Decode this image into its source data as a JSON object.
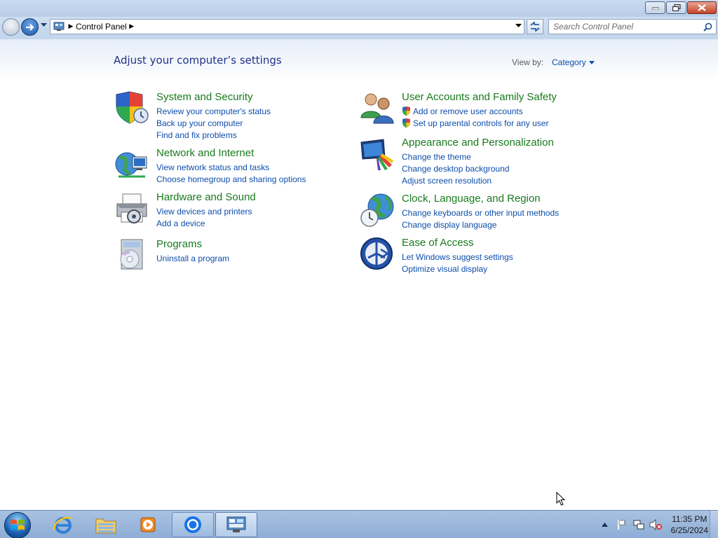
{
  "window": {
    "minimize_icon": "minimize-icon",
    "restore_icon": "restore-icon",
    "close_icon": "close-icon"
  },
  "address": {
    "crumb": "Control Panel",
    "search_placeholder": "Search Control Panel"
  },
  "header": {
    "title": "Adjust your computer’s settings",
    "view_by_label": "View by:",
    "view_by_value": "Category"
  },
  "categories": [
    {
      "title": "System and Security",
      "icon": "shield-icon",
      "links": [
        "Review your computer's status",
        "Back up your computer",
        "Find and fix problems"
      ]
    },
    {
      "title": "Network and Internet",
      "icon": "network-globe-icon",
      "links": [
        "View network status and tasks",
        "Choose homegroup and sharing options"
      ]
    },
    {
      "title": "Hardware and Sound",
      "icon": "printer-icon",
      "links": [
        "View devices and printers",
        "Add a device"
      ]
    },
    {
      "title": "Programs",
      "icon": "programs-cd-icon",
      "links": [
        "Uninstall a program"
      ]
    },
    {
      "title": "User Accounts and Family Safety",
      "icon": "users-icon",
      "links": [
        "Add or remove user accounts",
        "Set up parental controls for any user"
      ]
    },
    {
      "title": "Appearance and Personalization",
      "icon": "monitor-paint-icon",
      "links": [
        "Change the theme",
        "Change desktop background",
        "Adjust screen resolution"
      ]
    },
    {
      "title": "Clock, Language, and Region",
      "icon": "clock-globe-icon",
      "links": [
        "Change keyboards or other input methods",
        "Change display language"
      ]
    },
    {
      "title": "Ease of Access",
      "icon": "ease-of-access-icon",
      "links": [
        "Let Windows suggest settings",
        "Optimize visual display"
      ]
    }
  ],
  "taskbar": {
    "time": "11:35 PM",
    "date": "6/25/2024"
  },
  "colors": {
    "link": "#0d4eab",
    "category_title": "#187a1c",
    "page_title": "#1e3287"
  }
}
